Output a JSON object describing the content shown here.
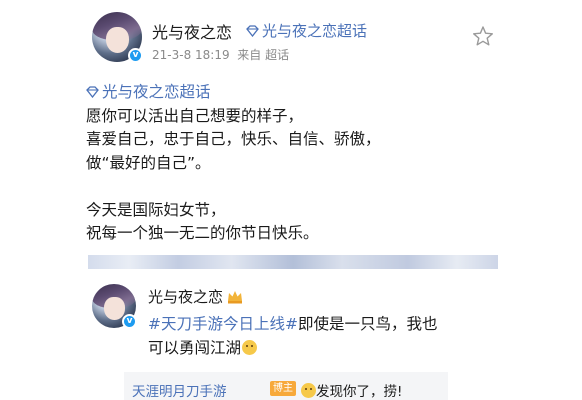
{
  "post": {
    "author_name": "光与夜之恋",
    "chaohua_tag": "光与夜之恋超话",
    "timestamp": "21-3-8 18:19",
    "source": "来自 超话",
    "body_tag": "光与夜之恋超话",
    "lines": [
      "愿你可以活出自己想要的样子，",
      "喜爱自己，忠于自己，快乐、自信、骄傲，",
      "做“最好的自己”。",
      "今天是国际妇女节，",
      "祝每一个独一无二的你节日快乐。"
    ],
    "star_icon": "star-outline-icon",
    "verified_icon": "verified-badge-icon"
  },
  "comment": {
    "author_name": "光与夜之恋",
    "topic": "#天刀手游今日上线#",
    "text_part1": "即使是一只鸟，我也",
    "text_part2": "可以勇闯江湖",
    "emoji_icon": "smile-emoji-icon",
    "reply": {
      "author": "天涯明月刀手游",
      "badge": "博主",
      "text": "发现你了，捞!"
    }
  },
  "colors": {
    "link_blue": "#4b72b8",
    "verified_blue": "#1d9bf0",
    "blogger_orange": "#f7a93b",
    "meta_gray": "#8a8a8a"
  }
}
